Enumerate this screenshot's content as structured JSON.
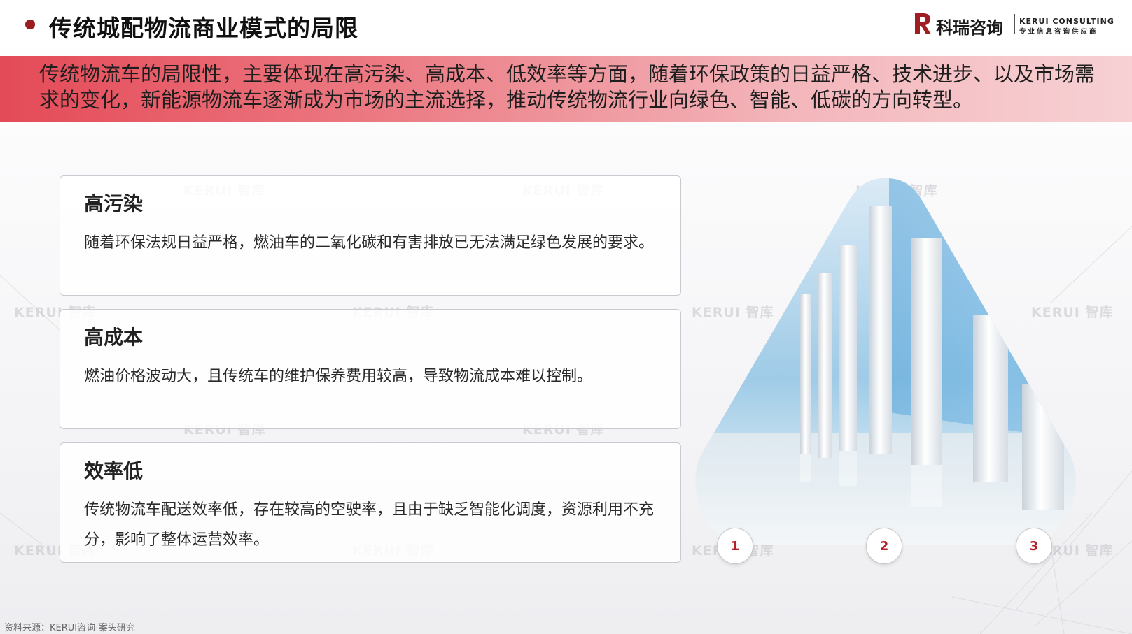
{
  "header": {
    "title": "传统城配物流商业模式的局限",
    "logo_cn": "科瑞咨询",
    "logo_en": "KERUI CONSULTING",
    "logo_sub": "专业信息咨询供应商"
  },
  "banner": {
    "text": "传统物流车的局限性，主要体现在高污染、高成本、低效率等方面，随着环保政策的日益严格、技术进步、以及市场需求的变化，新能源物流车逐渐成为市场的主流选择，推动传统物流行业向绿色、智能、低碳的方向转型。"
  },
  "cards": [
    {
      "title": "高污染",
      "body": "随着环保法规日益严格，燃油车的二氧化碳和有害排放已无法满足绿色发展的要求。"
    },
    {
      "title": "高成本",
      "body": "燃油价格波动大，且传统车的维护保养费用较高，导致物流成本难以控制。"
    },
    {
      "title": "效率低",
      "body": "传统物流车配送效率低，存在较高的空驶率，且由于缺乏智能化调度，资源利用不充分，影响了整体运营效率。"
    }
  ],
  "markers": [
    "1",
    "2",
    "3"
  ],
  "watermark": "KERUI 智库",
  "source": "资料来源：KERUI咨询-案头研究",
  "colors": {
    "brand": "#9b1c20",
    "banner_start": "#e44a57",
    "banner_end": "#f7d1d4"
  }
}
